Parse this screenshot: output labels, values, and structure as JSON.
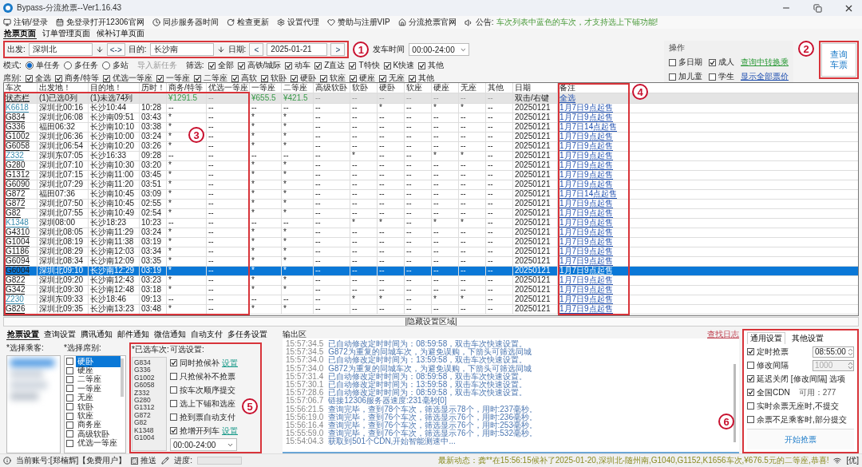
{
  "window": {
    "title": "Bypass-分流抢票--Ver1.16.43"
  },
  "toolbar": [
    {
      "kind": "monitor",
      "label": "注销/登录"
    },
    {
      "kind": "calendar",
      "label": "免登录打开12306官网"
    },
    {
      "kind": "clock",
      "label": "同步服务器时间"
    },
    {
      "kind": "refresh",
      "label": "检查更新"
    },
    {
      "kind": "gear",
      "label": "设置代理"
    },
    {
      "kind": "heart",
      "label": "赞助与注册VIP"
    },
    {
      "kind": "home",
      "label": "分流抢票官网"
    }
  ],
  "notice": {
    "label": "公告:",
    "text": "车次列表中蓝色的车次，才支持选上下铺功能!"
  },
  "page_tabs": [
    {
      "label": "抢票页面",
      "selected": true
    },
    {
      "label": "订单管理页面",
      "selected": false
    },
    {
      "label": "候补订单页面",
      "selected": false
    }
  ],
  "query": {
    "from_label": "出发:",
    "from": "深圳北",
    "swap": "<->",
    "to_label": "目的:",
    "to": "长沙南",
    "date_label": "日期:",
    "prev": "<",
    "date": "2025-01-21",
    "next": ">",
    "time_label": "发车时间",
    "time": "00:00-24:00"
  },
  "mode": {
    "label": "模式:",
    "options": [
      {
        "label": "单任务",
        "selected": true
      },
      {
        "label": "多任务",
        "selected": false
      },
      {
        "label": "多站",
        "selected": false
      }
    ],
    "import_button": "导入新任务",
    "filter_label": "筛选:",
    "filters": [
      {
        "label": "全部",
        "checked": true
      },
      {
        "label": "高铁/城际",
        "checked": true
      },
      {
        "label": "动车",
        "checked": true
      },
      {
        "label": "Z直达",
        "checked": true
      },
      {
        "label": "T特快",
        "checked": true
      },
      {
        "label": "K快速",
        "checked": true
      },
      {
        "label": "其他",
        "checked": true
      }
    ]
  },
  "seat_filter": {
    "label": "席别:",
    "options": [
      {
        "label": "全选",
        "checked": true
      },
      {
        "label": "商务/特等",
        "checked": true
      },
      {
        "label": "优选一等座",
        "checked": true
      },
      {
        "label": "一等座",
        "checked": true
      },
      {
        "label": "二等座",
        "checked": true
      },
      {
        "label": "高软",
        "checked": true
      },
      {
        "label": "软卧",
        "checked": true
      },
      {
        "label": "硬卧",
        "checked": true
      },
      {
        "label": "软座",
        "checked": true
      },
      {
        "label": "硬座",
        "checked": true
      },
      {
        "label": "无座",
        "checked": true
      },
      {
        "label": "其他",
        "checked": true
      }
    ]
  },
  "actions": {
    "title": "操作",
    "options": [
      {
        "label": "多日期",
        "checked": false
      },
      {
        "label": "成人",
        "checked": true
      },
      {
        "label": "加儿童",
        "checked": false
      },
      {
        "label": "学生",
        "checked": false
      }
    ],
    "links": [
      {
        "label": "查询中转换乘",
        "color": "#2e9b3a"
      },
      {
        "label": "显示全部票价",
        "color": "#1f4fb0"
      }
    ],
    "query_button": "查询车票"
  },
  "table": {
    "columns": [
      "车次",
      "出发地！",
      "目的地！",
      "历时！",
      "商务/特等",
      "优选一等座",
      "一等座",
      "二等座",
      "高级软卧",
      "软卧",
      "硬卧",
      "软座",
      "硬座",
      "无座",
      "其他",
      "日期",
      "备注"
    ],
    "summary": [
      {
        "kind": "label",
        "text": "状态栏"
      },
      {
        "kind": "count",
        "text": "(1)已选0列"
      },
      {
        "kind": "count",
        "text": "(1)未选74列"
      },
      {
        "kind": "empty"
      },
      {
        "kind": "price",
        "text": "¥1291.5"
      },
      {
        "kind": "dash",
        "text": "--"
      },
      {
        "kind": "price",
        "text": "¥655.5"
      },
      {
        "kind": "price",
        "text": "¥421.5"
      },
      {
        "kind": "dash",
        "text": "--"
      },
      {
        "kind": "dash",
        "text": "--"
      },
      {
        "kind": "dash",
        "text": "--"
      },
      {
        "kind": "dash",
        "text": "--"
      },
      {
        "kind": "dash",
        "text": "--"
      },
      {
        "kind": "dash",
        "text": "--"
      },
      {
        "kind": "dash",
        "text": "--"
      },
      {
        "kind": "count",
        "text": "双击/右键"
      },
      {
        "kind": "link",
        "text": "全选"
      }
    ],
    "rows": [
      {
        "cells": [
          "K6618",
          "深圳北00:16",
          "长沙10:44",
          "10:28",
          "--",
          "--",
          "--",
          "--",
          "--",
          "--",
          "*",
          "--",
          "*",
          "*",
          "--",
          "20250121",
          "1月7日9点起售"
        ],
        "color": "#3d8fb0",
        "selected": false
      },
      {
        "cells": [
          "G834",
          "深圳北06:08",
          "长沙南09:51",
          "03:43",
          "*",
          "--",
          "*",
          "*",
          "--",
          "--",
          "--",
          "--",
          "--",
          "--",
          "--",
          "20250121",
          "1月7日9点起售"
        ],
        "color": "#1a1a1a",
        "selected": false
      },
      {
        "cells": [
          "G336",
          "福田06:32",
          "长沙南10:10",
          "03:38",
          "*",
          "--",
          "*",
          "*",
          "--",
          "--",
          "--",
          "--",
          "--",
          "--",
          "--",
          "20250121",
          "1月7日14点起售"
        ],
        "color": "#1a1a1a",
        "selected": false
      },
      {
        "cells": [
          "G1002",
          "深圳北06:36",
          "长沙南10:00",
          "03:24",
          "*",
          "--",
          "*",
          "*",
          "--",
          "--",
          "--",
          "--",
          "--",
          "--",
          "--",
          "20250121",
          "1月7日9点起售"
        ],
        "color": "#1a1a1a",
        "selected": false
      },
      {
        "cells": [
          "G6058",
          "深圳北06:54",
          "长沙南10:20",
          "03:26",
          "*",
          "--",
          "*",
          "*",
          "--",
          "--",
          "--",
          "--",
          "--",
          "--",
          "--",
          "20250121",
          "1月7日9点起售"
        ],
        "color": "#1a1a1a",
        "selected": false
      },
      {
        "cells": [
          "Z332",
          "深圳东07:05",
          "长沙16:33",
          "09:28",
          "--",
          "--",
          "--",
          "--",
          "--",
          "*",
          "--",
          "--",
          "*",
          "*",
          "--",
          "20250121",
          "1月7日9点起售"
        ],
        "color": "#3d8fb0",
        "selected": false
      },
      {
        "cells": [
          "G280",
          "深圳北07:10",
          "长沙南10:30",
          "03:20",
          "*",
          "--",
          "*",
          "*",
          "--",
          "--",
          "--",
          "--",
          "--",
          "--",
          "--",
          "20250121",
          "1月7日9点起售"
        ],
        "color": "#1a1a1a",
        "selected": false
      },
      {
        "cells": [
          "G1312",
          "深圳北07:15",
          "长沙南11:00",
          "03:45",
          "*",
          "--",
          "*",
          "*",
          "--",
          "--",
          "--",
          "--",
          "--",
          "--",
          "--",
          "20250121",
          "1月7日9点起售"
        ],
        "color": "#1a1a1a",
        "selected": false
      },
      {
        "cells": [
          "G6090",
          "深圳北07:29",
          "长沙南11:20",
          "03:51",
          "*",
          "--",
          "*",
          "*",
          "--",
          "--",
          "--",
          "--",
          "--",
          "--",
          "--",
          "20250121",
          "1月7日9点起售"
        ],
        "color": "#1a1a1a",
        "selected": false
      },
      {
        "cells": [
          "G872",
          "福田07:36",
          "长沙南10:45",
          "03:09",
          "*",
          "--",
          "*",
          "*",
          "--",
          "--",
          "--",
          "--",
          "--",
          "--",
          "--",
          "20250121",
          "1月7日14点起售"
        ],
        "color": "#1a1a1a",
        "selected": false
      },
      {
        "cells": [
          "G872",
          "深圳北07:50",
          "长沙南10:45",
          "02:55",
          "*",
          "--",
          "*",
          "*",
          "--",
          "--",
          "--",
          "--",
          "--",
          "--",
          "--",
          "20250121",
          "1月7日9点起售"
        ],
        "color": "#1a1a1a",
        "selected": false
      },
      {
        "cells": [
          "G82",
          "深圳北07:55",
          "长沙南10:49",
          "02:54",
          "*",
          "--",
          "*",
          "*",
          "--",
          "--",
          "--",
          "--",
          "--",
          "--",
          "--",
          "20250121",
          "1月7日9点起售"
        ],
        "color": "#1a1a1a",
        "selected": false
      },
      {
        "cells": [
          "K1348",
          "深圳08:00",
          "长沙18:23",
          "10:23",
          "--",
          "--",
          "--",
          "--",
          "--",
          "*",
          "*",
          "--",
          "*",
          "*",
          "--",
          "20250121",
          "1月7日9点起售"
        ],
        "color": "#3d8fb0",
        "selected": false
      },
      {
        "cells": [
          "G4310",
          "深圳北08:05",
          "长沙南11:29",
          "03:24",
          "*",
          "--",
          "*",
          "*",
          "--",
          "--",
          "--",
          "--",
          "--",
          "--",
          "--",
          "20250121",
          "1月7日9点起售"
        ],
        "color": "#1a1a1a",
        "selected": false
      },
      {
        "cells": [
          "G1004",
          "深圳北08:19",
          "长沙南11:38",
          "03:19",
          "*",
          "--",
          "*",
          "*",
          "--",
          "--",
          "--",
          "--",
          "--",
          "--",
          "--",
          "20250121",
          "1月7日9点起售"
        ],
        "color": "#1a1a1a",
        "selected": false
      },
      {
        "cells": [
          "G1186",
          "深圳北08:29",
          "长沙南12:03",
          "03:34",
          "*",
          "--",
          "*",
          "*",
          "--",
          "--",
          "--",
          "--",
          "--",
          "--",
          "--",
          "20250121",
          "1月7日9点起售"
        ],
        "color": "#1a1a1a",
        "selected": false
      },
      {
        "cells": [
          "G6094",
          "深圳北08:34",
          "长沙南12:09",
          "03:35",
          "*",
          "--",
          "*",
          "*",
          "--",
          "--",
          "--",
          "--",
          "--",
          "--",
          "--",
          "20250121",
          "1月7日9点起售"
        ],
        "color": "#1a1a1a",
        "selected": false
      },
      {
        "cells": [
          "G6004",
          "深圳北09:10",
          "长沙南12:29",
          "03:19",
          "*",
          "--",
          "*",
          "*",
          "--",
          "--",
          "--",
          "--",
          "--",
          "--",
          "--",
          "20250121",
          "1月7日9点起售"
        ],
        "color": "#1a1a1a",
        "selected": true
      },
      {
        "cells": [
          "G822",
          "深圳北09:20",
          "长沙南12:43",
          "03:23",
          "*",
          "--",
          "*",
          "*",
          "--",
          "--",
          "--",
          "--",
          "--",
          "--",
          "--",
          "20250121",
          "1月7日9点起售"
        ],
        "color": "#1a1a1a",
        "selected": false
      },
      {
        "cells": [
          "G342",
          "深圳北09:30",
          "长沙南12:48",
          "03:18",
          "*",
          "--",
          "*",
          "*",
          "--",
          "--",
          "--",
          "--",
          "--",
          "--",
          "--",
          "20250121",
          "1月7日9点起售"
        ],
        "color": "#1a1a1a",
        "selected": false
      },
      {
        "cells": [
          "Z230",
          "深圳东09:33",
          "长沙18:46",
          "09:13",
          "--",
          "--",
          "--",
          "--",
          "--",
          "*",
          "*",
          "--",
          "*",
          "*",
          "--",
          "20250121",
          "1月7日9点起售"
        ],
        "color": "#3d8fb0",
        "selected": false
      },
      {
        "cells": [
          "G826",
          "深圳北09:35",
          "长沙南13:23",
          "03:48",
          "*",
          "--",
          "*",
          "*",
          "--",
          "--",
          "--",
          "--",
          "--",
          "--",
          "--",
          "20250121",
          "1月7日9点起售"
        ],
        "color": "#1a1a1a",
        "selected": false
      }
    ]
  },
  "hide_bar": "|隐藏设置区域|",
  "settings_tabs": [
    {
      "label": "抢票设置",
      "selected": true
    },
    {
      "label": "查询设置",
      "selected": false
    },
    {
      "label": "腾讯通知",
      "selected": false
    },
    {
      "label": "邮件通知",
      "selected": false
    },
    {
      "label": "微信通知",
      "selected": false
    },
    {
      "label": "自动支付",
      "selected": false
    },
    {
      "label": "多任务设置",
      "selected": false
    }
  ],
  "passengers": {
    "label": "*选择乘客:"
  },
  "seats": {
    "label": "*选择席别:",
    "items": [
      {
        "label": "硬卧",
        "checked": false,
        "selected": true
      },
      {
        "label": "硬座",
        "checked": false,
        "selected": false
      },
      {
        "label": "二等座",
        "checked": false,
        "selected": false
      },
      {
        "label": "一等座",
        "checked": false,
        "selected": false
      },
      {
        "label": "无座",
        "checked": false,
        "selected": false
      },
      {
        "label": "软卧",
        "checked": false,
        "selected": false
      },
      {
        "label": "软座",
        "checked": false,
        "selected": false
      },
      {
        "label": "商务座",
        "checked": false,
        "selected": false
      },
      {
        "label": "高级软卧",
        "checked": false,
        "selected": false
      },
      {
        "label": "优选一等座",
        "checked": false,
        "selected": false
      }
    ]
  },
  "selected_trains": {
    "label": "*已选车次:",
    "items": [
      "G834",
      "G336",
      "G1002",
      "G6058",
      "Z332",
      "G280",
      "G1312",
      "G872",
      "G82",
      "K1348",
      "G1004"
    ]
  },
  "options": {
    "label": "可选设置:",
    "items": [
      {
        "label": "同时抢候补",
        "checked": true,
        "link": "设置"
      },
      {
        "label": "只抢候补不抢票",
        "checked": false
      },
      {
        "label": "按车次顺序提交",
        "checked": false
      },
      {
        "label": "选上下铺和选座",
        "checked": false
      },
      {
        "label": "抢到票自动支付",
        "checked": false
      },
      {
        "label": "抢增开列车",
        "checked": true,
        "link": "设置"
      }
    ],
    "time": "00:00-24:00"
  },
  "output": {
    "label": "输出区",
    "search": "查找日志",
    "lines": [
      {
        "time": "15:57:34.5",
        "text": "已自动修改定时时间为：08:59:58，双击车次快速设置。"
      },
      {
        "time": "15:57:34.5",
        "text": "G872为重复的同城车次，为避免误购，下箭头可筛选同城"
      },
      {
        "time": "15:57:34.0",
        "text": "已自动修改定时时间为：13:59:58，双击车次快速设置。"
      },
      {
        "time": "15:57:34.0",
        "text": "G872为重复的同城车次，为避免误购，下箭头可筛选同城"
      },
      {
        "time": "15:57:31.4",
        "text": "已自动修改定时时间为：08:59:58，双击车次快速设置。"
      },
      {
        "time": "15:57:30.1",
        "text": "已自动修改定时时间为：13:59:58，双击车次快速设置。"
      },
      {
        "time": "15:57:28.6",
        "text": "已自动修改定时时间为：08:59:58，双击车次快速设置。"
      },
      {
        "time": "15:57:06.7",
        "text": "链接12306服务器速度:231毫秒[0]"
      },
      {
        "time": "15:56:21.5",
        "text": "查询完毕，查到78个车次，筛选显示78个，用时:237毫秒。"
      },
      {
        "time": "15:56:19.0",
        "text": "查询完毕，查到76个车次，筛选显示76个，用时:236毫秒。"
      },
      {
        "time": "15:56:16.4",
        "text": "查询完毕，查到76个车次，筛选显示76个，用时:253毫秒。"
      },
      {
        "time": "15:55:59.0",
        "text": "查询完毕，查到76个车次，筛选显示76个，用时:532毫秒。"
      },
      {
        "time": "15:54:04.3",
        "text": "获取到501个CDN,开始智能测速中..."
      }
    ]
  },
  "general": {
    "tabs": [
      {
        "label": "通用设置",
        "selected": true
      },
      {
        "label": "其他设置",
        "selected": false
      }
    ],
    "rows": [
      {
        "kind": "spin",
        "label": "定时抢票",
        "checked": true,
        "value": "08:55:00",
        "disabled": false
      },
      {
        "kind": "spin",
        "label": "修改间隔",
        "checked": false,
        "value": "1000",
        "disabled": true
      },
      {
        "kind": "plain",
        "label": "延迟关闭 [修改间隔] 选项",
        "checked": true
      },
      {
        "kind": "info",
        "label": "全国CDN",
        "checked": true,
        "info": "可用：277"
      },
      {
        "kind": "plain",
        "label": "实时余票无座时,不提交",
        "checked": false
      },
      {
        "kind": "plain",
        "label": "余票不足乘客时,部分提交",
        "checked": false
      }
    ],
    "start_button": "开始抢票"
  },
  "annotations": [
    {
      "number": "1"
    },
    {
      "number": "2"
    },
    {
      "number": "3"
    },
    {
      "number": "4"
    },
    {
      "number": "5"
    },
    {
      "number": "6"
    }
  ],
  "status_bar": {
    "account": "当前账号:[郑楠辉]【免费用户】",
    "push": "推送",
    "push_checked": true,
    "progress_label": "进度:",
    "progress": {
      "level": 0
    },
    "news": "最新动态：龚**在15:56:15候补了2025-01-20,深圳北-随州南,G1040,G1152,K1656车次,¥676.5元的二等座,恭喜!",
    "signal": "[优]"
  }
}
